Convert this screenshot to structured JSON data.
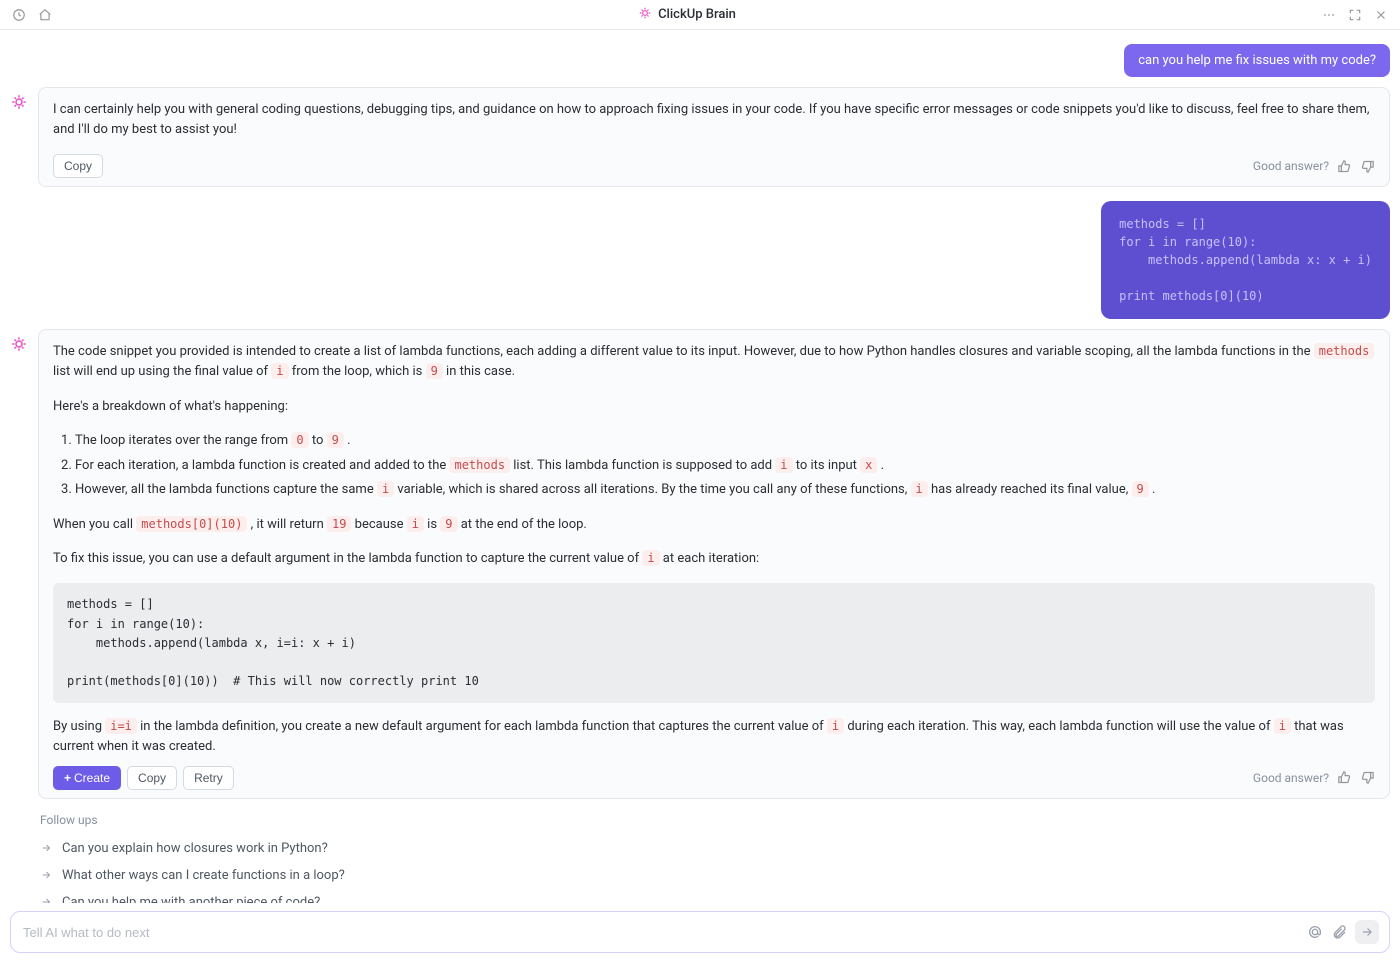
{
  "header": {
    "title": "ClickUp Brain"
  },
  "messages": {
    "user1": "can you help me fix issues with my code?",
    "ai1": "I can certainly help you with general coding questions, debugging tips, and guidance on how to approach fixing issues in your code. If you have specific error messages or code snippets you'd like to discuss, feel free to share them, and I'll do my best to assist you!",
    "user2_code": "methods = []\nfor i in range(10):\n    methods.append(lambda x: x + i)\n\nprint methods[0](10)",
    "ai2": {
      "p1a": "The code snippet you provided is intended to create a list of lambda functions, each adding a different value to its input. However, due to how Python handles closures and variable scoping, all the lambda functions in the ",
      "c1": "methods",
      "p1b": " list will end up using the final value of ",
      "c2": "i",
      "p1c": " from the loop, which is ",
      "c3": "9",
      "p1d": " in this case.",
      "p2": "Here's a breakdown of what's happening:",
      "li1a": "The loop iterates over the range from ",
      "li1c1": "0",
      "li1b": " to ",
      "li1c2": "9",
      "li1c": " .",
      "li2a": "For each iteration, a lambda function is created and added to the ",
      "li2c1": "methods",
      "li2b": " list. This lambda function is supposed to add ",
      "li2c2": "i",
      "li2c": " to its input ",
      "li2c3": "x",
      "li2d": " .",
      "li3a": "However, all the lambda functions capture the same ",
      "li3c1": "i",
      "li3b": " variable, which is shared across all iterations. By the time you call any of these functions, ",
      "li3c2": "i",
      "li3c": " has already reached its final value, ",
      "li3c3": "9",
      "li3d": " .",
      "p3a": "When you call ",
      "p3c1": "methods[0](10)",
      "p3b": " , it will return ",
      "p3c2": "19",
      "p3c": " because ",
      "p3c3": "i",
      "p3d": " is ",
      "p3c4": "9",
      "p3e": " at the end of the loop.",
      "p4a": "To fix this issue, you can use a default argument in the lambda function to capture the current value of ",
      "p4c1": "i",
      "p4b": " at each iteration:",
      "code": "methods = []\nfor i in range(10):\n    methods.append(lambda x, i=i: x + i)\n\nprint(methods[0](10))  # This will now correctly print 10",
      "p5a": "By using ",
      "p5c1": "i=i",
      "p5b": " in the lambda definition, you create a new default argument for each lambda function that captures the current value of ",
      "p5c2": "i",
      "p5c": " during each iteration. This way, each lambda function will use the value of ",
      "p5c3": "i",
      "p5d": " that was current when it was created."
    }
  },
  "actions": {
    "copy": "Copy",
    "create": "Create",
    "retry": "Retry",
    "good_answer": "Good answer?"
  },
  "followups": {
    "title": "Follow ups",
    "items": [
      "Can you explain how closures work in Python?",
      "What other ways can I create functions in a loop?",
      "Can you help me with another piece of code?"
    ]
  },
  "composer": {
    "placeholder": "Tell AI what to do next"
  }
}
